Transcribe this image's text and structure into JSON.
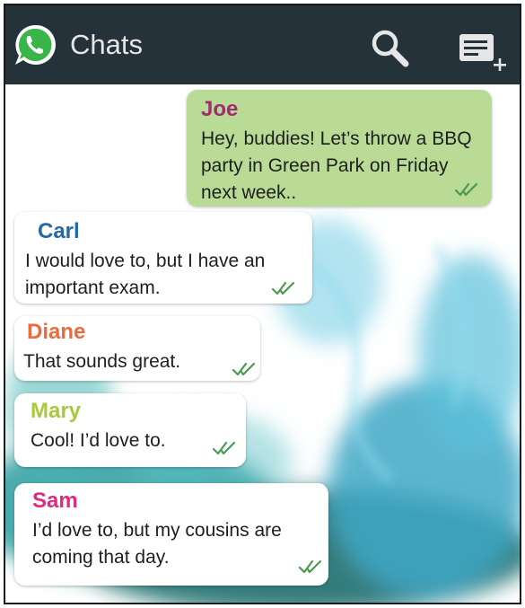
{
  "header": {
    "title": "Chats",
    "logo_icon": "whatsapp-logo-icon",
    "search_icon": "search-icon",
    "new_chat_icon": "new-chat-icon",
    "bar_color": "#26323a"
  },
  "messages": [
    {
      "sender": "Joe",
      "text": "Hey, buddies! Let’s throw a BBQ party in Green Park on Friday next week..",
      "sender_color": "#a32b73",
      "bubble_color": "#b9db96",
      "outgoing": true,
      "status_icon": "double-check-icon"
    },
    {
      "sender": "Carl",
      "text": "I would love to, but I have an important exam.",
      "sender_color": "#2568a6",
      "bubble_color": "#ffffff",
      "outgoing": false,
      "status_icon": "double-check-icon"
    },
    {
      "sender": "Diane",
      "text": "That sounds great.",
      "sender_color": "#ee6a3a",
      "bubble_color": "#ffffff",
      "outgoing": false,
      "status_icon": "double-check-icon"
    },
    {
      "sender": "Mary",
      "text": "Cool! I’d love to.",
      "sender_color": "#a8c93a",
      "bubble_color": "#ffffff",
      "outgoing": false,
      "status_icon": "double-check-icon"
    },
    {
      "sender": "Sam",
      "text": "I’d love to, but my cousins are coming that day.",
      "sender_color": "#e02b7e",
      "bubble_color": "#ffffff",
      "outgoing": false,
      "status_icon": "double-check-icon"
    }
  ],
  "tick_color": "#4a9a52"
}
